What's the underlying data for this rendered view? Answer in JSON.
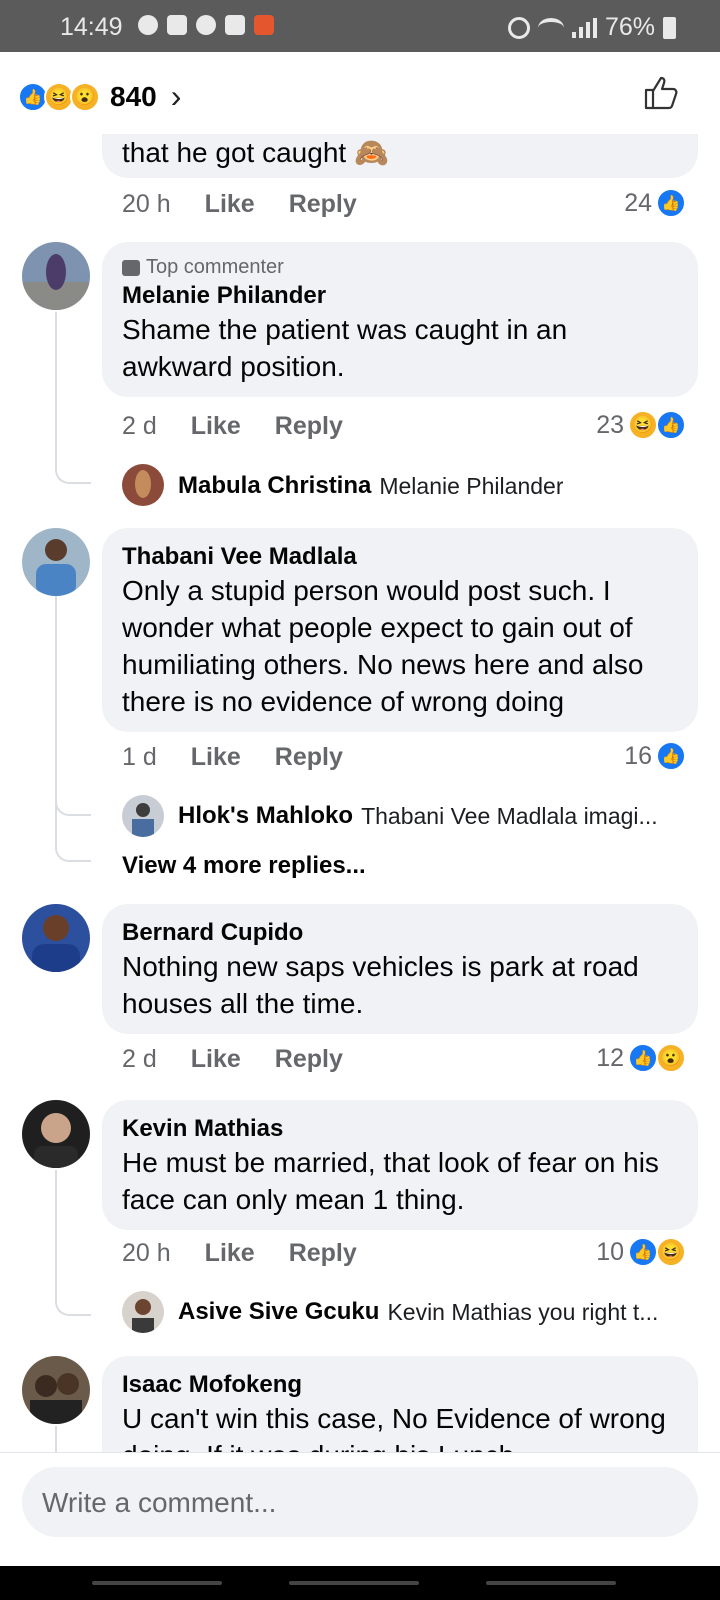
{
  "status_bar": {
    "time": "14:49",
    "battery": "76%"
  },
  "header": {
    "reaction_count": "840",
    "chevron": "›"
  },
  "comments": [
    {
      "tail_text": "that he got caught 🙈",
      "time": "20 h",
      "like": "Like",
      "reply": "Reply",
      "reaction_count": "24"
    },
    {
      "badge": "Top commenter",
      "name": "Melanie Philander",
      "text": "Shame the patient was  caught in an awkward position.",
      "time": "2 d",
      "like": "Like",
      "reply": "Reply",
      "reaction_count": "23",
      "reply_preview": {
        "name": "Mabula Christina",
        "text": "Melanie Philander"
      }
    },
    {
      "name": "Thabani Vee Madlala",
      "text": "Only a stupid person would post such. I wonder what people expect to gain out of humiliating others. No news here and also there is no evidence of wrong doing",
      "time": "1 d",
      "like": "Like",
      "reply": "Reply",
      "reaction_count": "16",
      "reply_preview": {
        "name": "Hlok's Mahloko",
        "text": "Thabani Vee Madlala imagi..."
      },
      "more_replies": "View 4 more replies..."
    },
    {
      "name": "Bernard Cupido",
      "text": "Nothing new saps vehicles is park at road houses all the time.",
      "time": "2 d",
      "like": "Like",
      "reply": "Reply",
      "reaction_count": "12"
    },
    {
      "name": "Kevin Mathias",
      "text": "He must be married, that look of fear on his face can only mean 1 thing.",
      "time": "20 h",
      "like": "Like",
      "reply": "Reply",
      "reaction_count": "10",
      "reply_preview": {
        "name": "Asive Sive Gcuku",
        "text": "Kevin Mathias  you right t..."
      }
    },
    {
      "name": "Isaac Mofokeng",
      "text": "U can't win this case, No Evidence of wrong doing. If it was during his Lunch"
    }
  ],
  "composer": {
    "placeholder": "Write a comment..."
  },
  "colors": {
    "like_blue": "#1877f2",
    "bubble": "#f0f2f5",
    "meta_gray": "#65676b",
    "emoji_yellow": "#f7b125"
  }
}
